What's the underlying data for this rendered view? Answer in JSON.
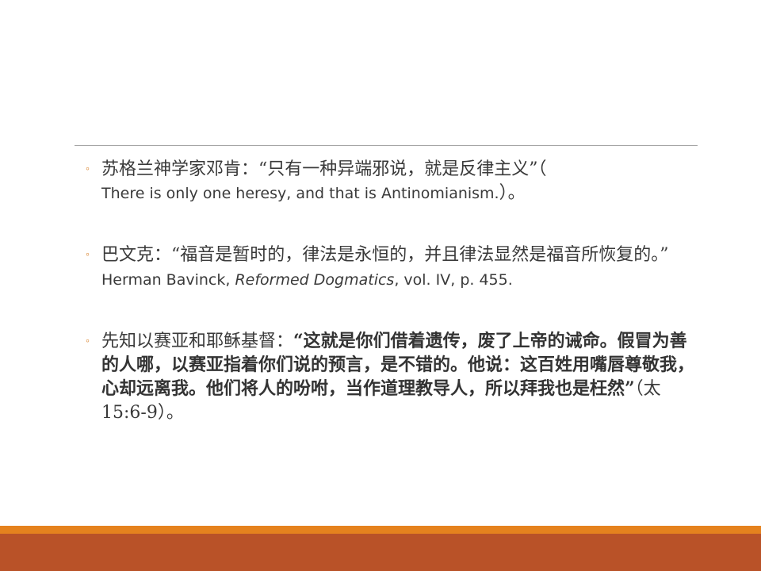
{
  "colors": {
    "accent": "#e5821e",
    "footer": "#b95228",
    "divider": "#a6a6a6",
    "text": "#3a3a3a"
  },
  "bullets": [
    {
      "icon": "circle-bullet-icon",
      "text_cn": "苏格兰神学家邓肯：“只有一种异端邪说，就是反律主义”（",
      "text_en": "There is only one heresy, and that is Antinomianism.",
      "text_tail": "）。"
    },
    {
      "icon": "circle-bullet-icon",
      "text_cn": "巴文克：“福音是暂时的，律法是永恒的，并且律法显然是福音所恢复的。”",
      "author": " Herman Bavinck, ",
      "book": "Reformed Dogmatics",
      "ref": ", vol. IV, p. 455."
    },
    {
      "icon": "circle-bullet-icon",
      "intro": "先知以赛亚和耶稣基督：",
      "quote": "“这就是你们借着遗传，废了上帝的诫命。假冒为善的人哪，以赛亚指着你们说的预言，是不错的。他说：这百姓用嘴唇尊敬我，心却远离我。他们将人的吩咐，当作道理教导人，所以拜我也是枉然”",
      "ref": "（太15:6-9）。"
    }
  ]
}
